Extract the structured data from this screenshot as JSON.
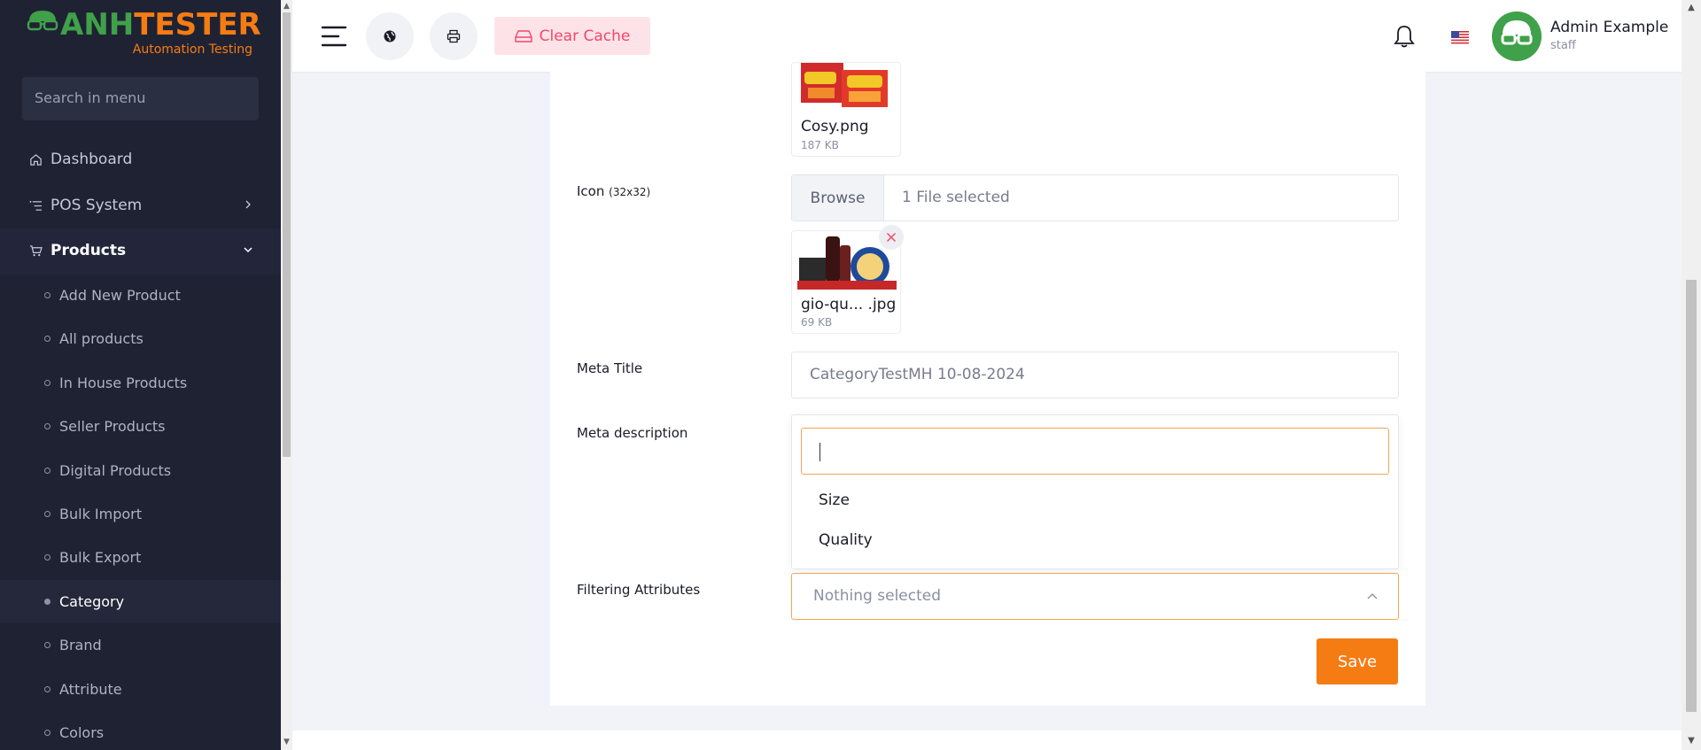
{
  "brand": {
    "name_part1": "ANH",
    "name_part2": "TESTER",
    "tagline": "Automation Testing",
    "green": "#3fa14a",
    "orange": "#f57c13"
  },
  "sidebar": {
    "search_placeholder": "Search in menu",
    "items": [
      {
        "label": "Dashboard",
        "icon": "home-icon"
      },
      {
        "label": "POS System",
        "icon": "list-icon"
      },
      {
        "label": "Products",
        "icon": "cart-icon"
      }
    ],
    "sub_items": [
      {
        "label": "Add New Product"
      },
      {
        "label": "All products"
      },
      {
        "label": "In House Products"
      },
      {
        "label": "Seller Products"
      },
      {
        "label": "Digital Products"
      },
      {
        "label": "Bulk Import"
      },
      {
        "label": "Bulk Export"
      },
      {
        "label": "Category"
      },
      {
        "label": "Brand"
      },
      {
        "label": "Attribute"
      },
      {
        "label": "Colors"
      }
    ]
  },
  "topbar": {
    "clear_cache": "Clear Cache",
    "user_name": "Admin Example",
    "user_role": "staff"
  },
  "form": {
    "banner_file": {
      "name": "Cosy.png",
      "size": "187 KB"
    },
    "icon_label": "Icon",
    "icon_hint": "(32x32)",
    "browse_label": "Browse",
    "icon_files_selected": "1 File selected",
    "icon_file": {
      "name": "gio-qu... .jpg",
      "size": "69 KB"
    },
    "meta_title_label": "Meta Title",
    "meta_title_value": "CategoryTestMH 10-08-2024",
    "meta_description_label": "Meta description",
    "filter_label": "Filtering Attributes",
    "filter_value": "Nothing selected",
    "filter_options": [
      "Size",
      "Quality"
    ],
    "save_label": "Save"
  }
}
